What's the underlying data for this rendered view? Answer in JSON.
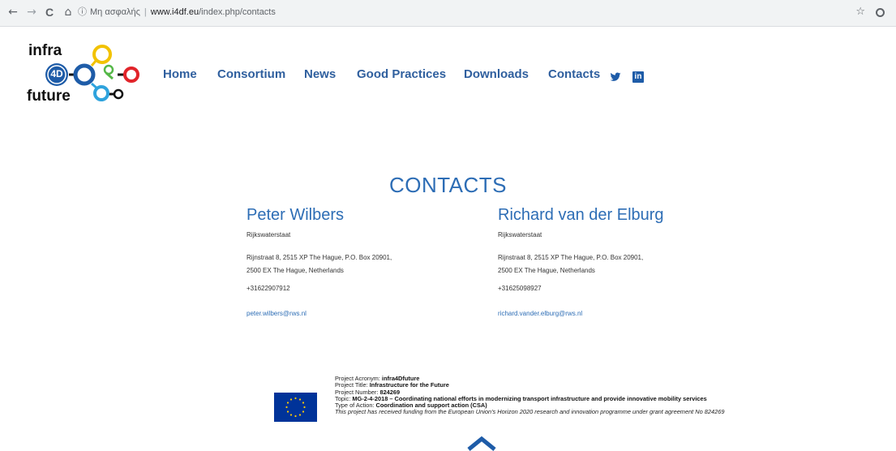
{
  "browser": {
    "back_icon": "←",
    "forward_icon": "→",
    "reload_icon": "C",
    "home_icon": "⌂",
    "info_icon": "ⓘ",
    "security_label": "Μη ασφαλής",
    "url_host": "www.i4df.eu",
    "url_path": "/index.php/contacts",
    "bookmark_icon": "☆"
  },
  "logo": {
    "word_top": "infra",
    "word_mid": "4D",
    "word_bottom": "future",
    "colors": {
      "yellow": "#f2c200",
      "blue": "#1e5ca8",
      "green": "#55b848",
      "red": "#e1242a",
      "lightblue": "#2fa3dd",
      "dark": "#111111"
    }
  },
  "nav": {
    "items": [
      "Home",
      "Consortium",
      "News",
      "Good Practices",
      "Downloads",
      "Contacts"
    ],
    "color": "#2f5f9e"
  },
  "social": {
    "twitter": "twitter-icon",
    "linkedin": "in"
  },
  "page": {
    "title": "CONTACTS",
    "accent": "#2d6db5"
  },
  "contacts": [
    {
      "name": "Peter Wilbers",
      "org": "Rijkswaterstaat",
      "address_line1": "Rijnstraat 8, 2515 XP The Hague, P.O. Box 20901,",
      "address_line2": "2500 EX The Hague, Netherlands",
      "phone": "+31622907912",
      "email": "peter.wilbers@rws.nl"
    },
    {
      "name": "Richard van der Elburg",
      "org": "Rijkswaterstaat",
      "address_line1": "Rijnstraat 8, 2515 XP The Hague, P.O. Box 20901,",
      "address_line2": "2500 EX The Hague, Netherlands",
      "phone": "+31625098927",
      "email": "richard.vander.elburg@rws.nl"
    }
  ],
  "footer": {
    "acronym_label": "Project Acronym: ",
    "acronym": "infra4Dfuture",
    "title_label": "Project Title: ",
    "title": "Infrastructure for the Future",
    "number_label": "Project Number: ",
    "number": "824269",
    "topic_label": "Topic: ",
    "topic": "MG-2-4-2018 – Coordinating national efforts in modernizing transport infrastructure and provide innovative mobility services",
    "action_label": "Type of Action: ",
    "action": "Coordination and support action (CSA)",
    "note": "This project has received funding from the European Union's Horizon 2020 research and innovation programme under grant agreement No 824269",
    "flag_color": "#003399",
    "star_color": "#ffcc00"
  }
}
